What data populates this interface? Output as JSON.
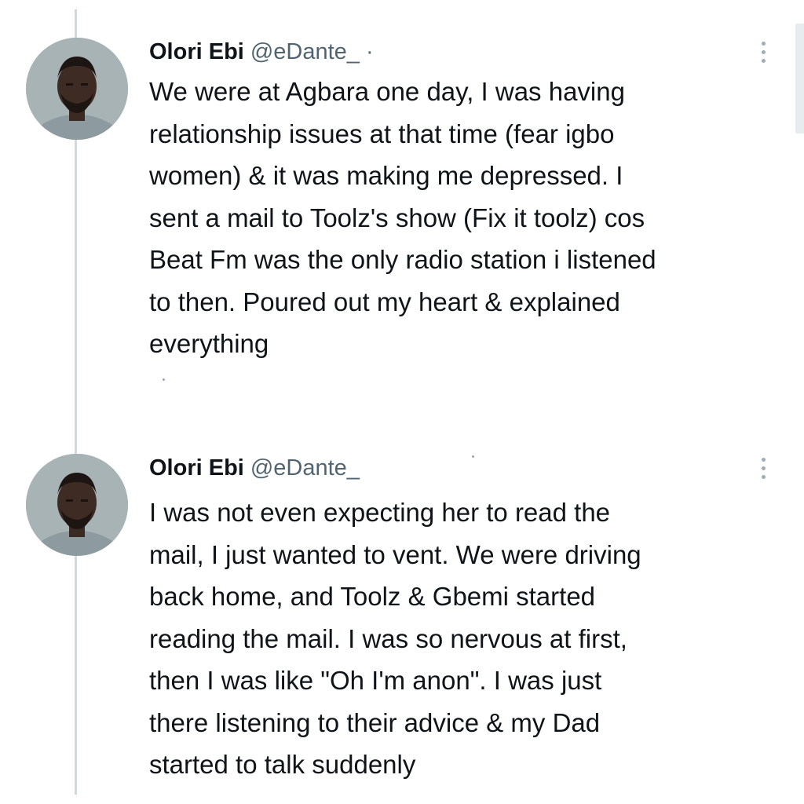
{
  "tweets": [
    {
      "author_name": "Olori Ebi",
      "handle": "@eDante_",
      "separator": "·",
      "avatar_icon": "profile-photo",
      "more_icon": "vertical-ellipsis-icon",
      "text": "We were at Agbara one day, I was having\nrelationship issues at that time (fear igbo\nwomen) & it was making me depressed. I\nsent a mail to Toolz's show (Fix it toolz) cos\nBeat Fm was the only radio station i listened\nto then. Poured out my heart & explained\neverything"
    },
    {
      "author_name": "Olori Ebi",
      "handle": "@eDante_",
      "avatar_icon": "profile-photo",
      "more_icon": "vertical-ellipsis-icon",
      "text": "I was not even expecting her to read the\nmail, I just wanted to vent. We were driving\nback home, and Toolz & Gbemi started\nreading the mail. I was so nervous at first,\nthen I was like \"Oh I'm anon\". I was just\nthere listening to their advice & my Dad\nstarted to talk suddenly"
    }
  ],
  "colors": {
    "text_primary": "#0f1419",
    "text_secondary": "#536471",
    "thread_line": "#cfd9de",
    "background": "#ffffff"
  }
}
